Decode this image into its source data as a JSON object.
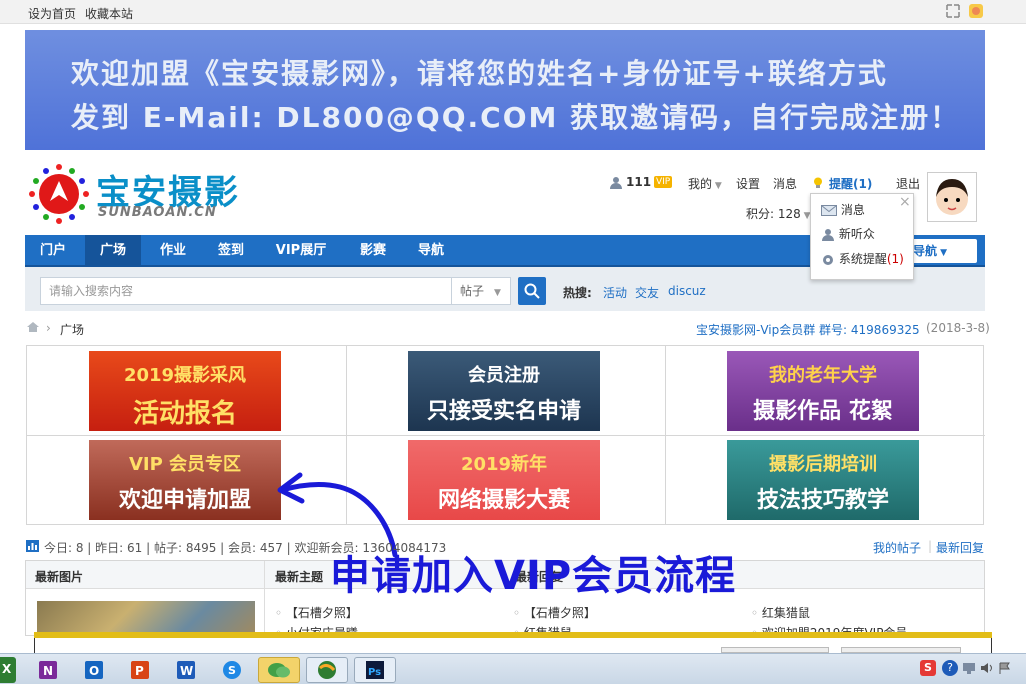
{
  "topbar": {
    "set_home": "设为首页",
    "bookmark": "收藏本站"
  },
  "banner": {
    "line1": "欢迎加盟《宝安摄影网》，请将您的姓名+身份证号+联络方式",
    "line2": "发到 E-Mail: DL800@QQ.COM 获取邀请码，自行完成注册！"
  },
  "logo": {
    "name": "宝安摄影",
    "sub": "SUNBAOAN.CN"
  },
  "user": {
    "username": "111",
    "vip_badge": "VIP",
    "my": "我的",
    "settings": "设置",
    "messages": "消息",
    "reminders": "提醒(1)",
    "logout": "退出",
    "points": "积分: 128"
  },
  "popup": {
    "messages": "消息",
    "new_listener": "新听众",
    "system": "系统提醒",
    "system_count": "(1)"
  },
  "nav": {
    "items": [
      "门户",
      "广场",
      "作业",
      "签到",
      "VIP展厅",
      "影赛",
      "导航"
    ],
    "right": "导航"
  },
  "search": {
    "placeholder": "请输入搜索内容",
    "type": "帖子",
    "hot_label": "热搜:",
    "hot": [
      "活动",
      "交友",
      "discuz"
    ]
  },
  "crumb": {
    "current": "广场",
    "group": "宝安摄影网-Vip会员群 群号: 419869325",
    "date": "(2018-3-8)"
  },
  "tiles": [
    {
      "a": "2019摄影采风",
      "b": "活动报名",
      "color": "#d93a1a"
    },
    {
      "a": "会员注册",
      "b": "只接受实名申请",
      "color": "#2b4a6a"
    },
    {
      "a": "我的老年大学",
      "b": "摄影作品 花絮",
      "color": "#7a3fa0"
    },
    {
      "a": "VIP 会员专区",
      "b": "欢迎申请加盟",
      "color": "#a84a3a"
    },
    {
      "a": "2019新年",
      "b": "网络摄影大赛",
      "color": "#ef5a5a"
    },
    {
      "a": "摄影后期培训",
      "b": "技法技巧教学",
      "color": "#2e8a8a"
    }
  ],
  "stats": {
    "text": "今日: 8 | 昨日: 61 | 帖子: 8495 | 会员: 457 | 欢迎新会员: 13604084173",
    "my_posts": "我的帖子",
    "latest_reply": "最新回复"
  },
  "bottom": {
    "h1": "最新图片",
    "h2": "最新主题",
    "h3": "最新回复",
    "col2": [
      "【石槽夕照】",
      "小付家庄晨曦"
    ],
    "col3": [
      "【石槽夕照】",
      "红集猎鼠"
    ],
    "col4": [
      "红集猎鼠",
      "欢迎加盟2019年度VIP会员"
    ]
  },
  "overlay": {
    "text": "申请加入VIP会员流程"
  }
}
